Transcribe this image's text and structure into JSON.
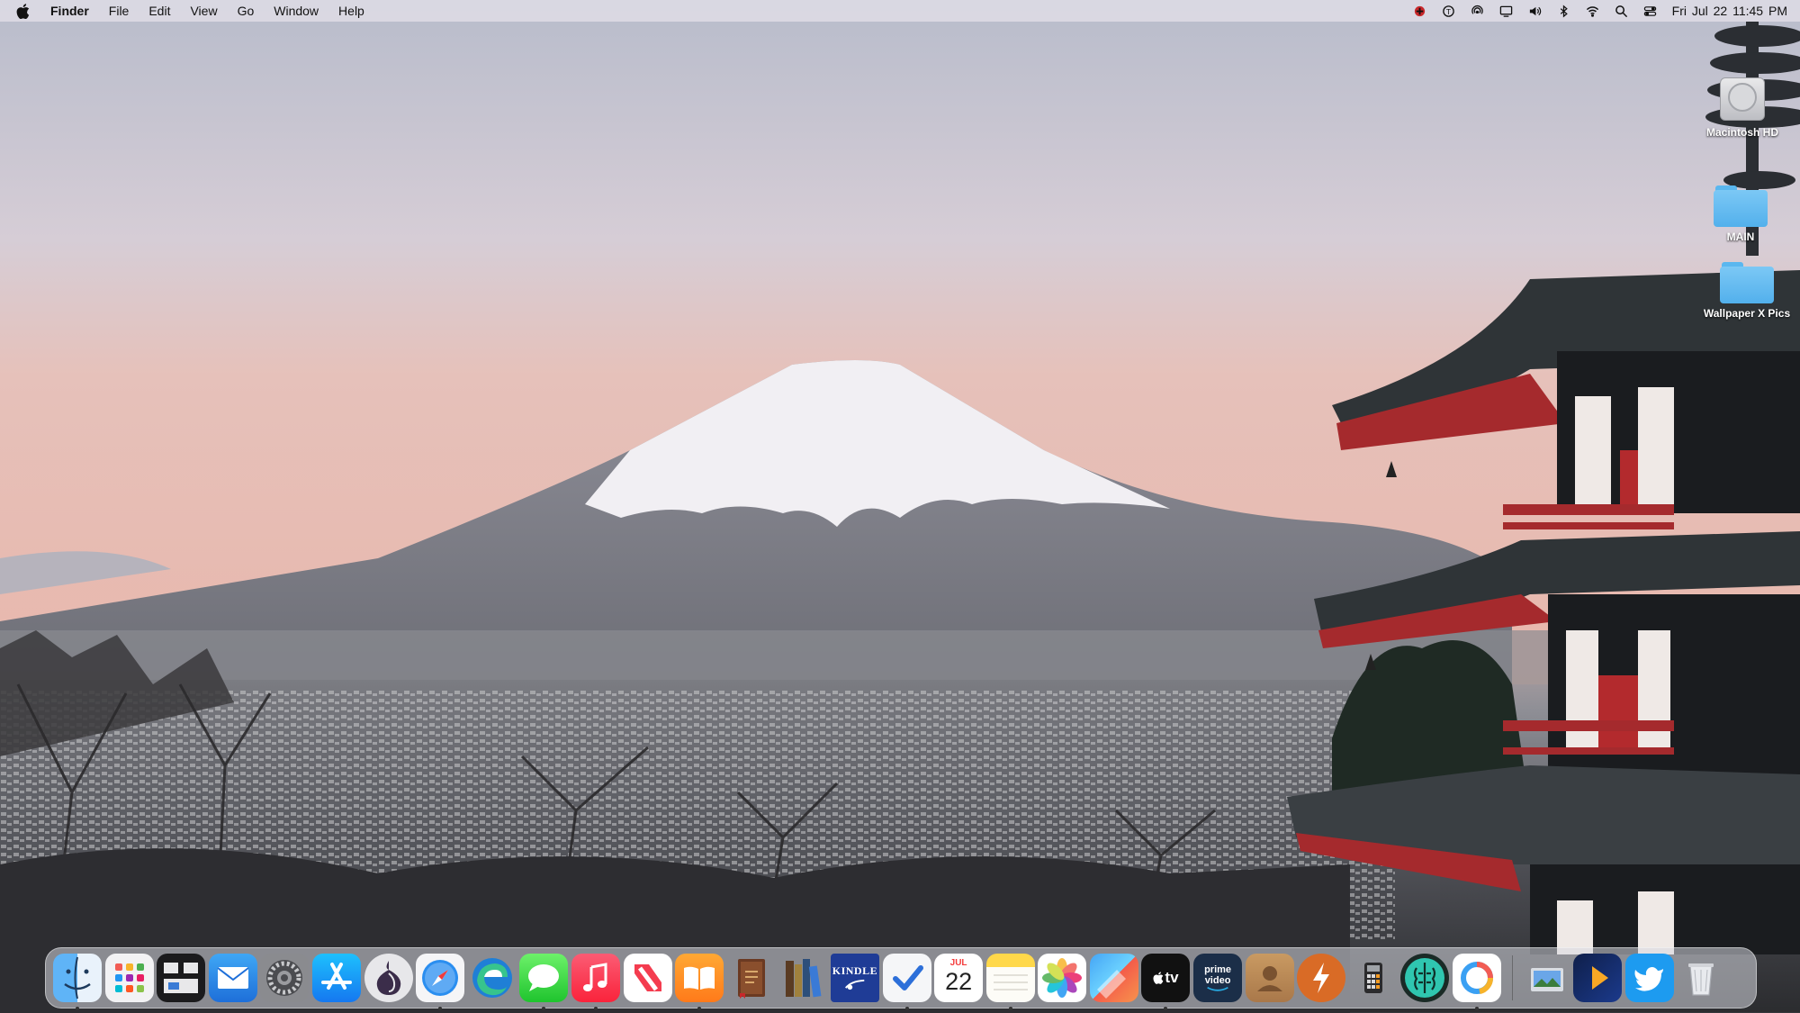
{
  "menubar": {
    "apple_icon": "apple-icon",
    "app_name": "Finder",
    "menus": [
      "File",
      "Edit",
      "View",
      "Go",
      "Window",
      "Help"
    ],
    "status_icons": [
      "antivirus-icon",
      "spotlight-helper-icon",
      "airdrop-icon",
      "display-icon",
      "volume-icon",
      "bluetooth-icon",
      "wifi-icon",
      "search-icon",
      "control-center-icon"
    ],
    "clock": "Fri Jul 22  11:45 PM"
  },
  "desktop_icons": [
    {
      "name": "macintosh-hd",
      "label": "Macintosh HD",
      "icon": "hard-drive-icon"
    },
    {
      "name": "main-folder",
      "label": "MAIN",
      "icon": "folder-icon"
    },
    {
      "name": "wallpaper-folder",
      "label": "Wallpaper X Pics",
      "icon": "folder-icon"
    }
  ],
  "dock": {
    "apps": [
      {
        "name": "finder",
        "icon": "finder-icon",
        "running": true
      },
      {
        "name": "launchpad",
        "icon": "launchpad-icon",
        "running": false
      },
      {
        "name": "mission-control",
        "icon": "mission-control-icon",
        "running": false
      },
      {
        "name": "mail",
        "icon": "mail-icon",
        "running": false
      },
      {
        "name": "system-preferences",
        "icon": "gear-icon",
        "running": false
      },
      {
        "name": "app-store",
        "icon": "app-store-icon",
        "running": false
      },
      {
        "name": "tor-browser",
        "icon": "onion-icon",
        "running": false
      },
      {
        "name": "safari",
        "icon": "compass-icon",
        "running": true
      },
      {
        "name": "edge",
        "icon": "edge-icon",
        "running": false
      },
      {
        "name": "messages",
        "icon": "speech-bubble-icon",
        "running": true
      },
      {
        "name": "music",
        "icon": "music-note-icon",
        "running": true
      },
      {
        "name": "news",
        "icon": "news-icon",
        "running": false
      },
      {
        "name": "books",
        "icon": "open-book-icon",
        "running": true
      },
      {
        "name": "audiobooks",
        "icon": "leather-book-icon",
        "running": false
      },
      {
        "name": "calibre",
        "icon": "bookshelf-icon",
        "running": false
      },
      {
        "name": "kindle",
        "icon": "kindle-icon",
        "label": "KINDLE",
        "running": false
      },
      {
        "name": "things",
        "icon": "checkmark-icon",
        "running": true
      },
      {
        "name": "calendar",
        "icon": "calendar-icon",
        "month": "JUL",
        "day": "22",
        "running": false
      },
      {
        "name": "notes",
        "icon": "notes-icon",
        "running": true
      },
      {
        "name": "photos",
        "icon": "photos-flower-icon",
        "running": false
      },
      {
        "name": "pixelmator",
        "icon": "paint-icon",
        "running": false
      },
      {
        "name": "apple-tv",
        "icon": "tv-icon",
        "label": "tv",
        "running": true
      },
      {
        "name": "prime-video",
        "icon": "prime-video-icon",
        "label": "prime video",
        "running": false
      },
      {
        "name": "contacts",
        "icon": "contacts-icon",
        "running": false
      },
      {
        "name": "reeder",
        "icon": "lightning-icon",
        "running": false
      },
      {
        "name": "calculator",
        "icon": "calculator-icon",
        "running": false
      },
      {
        "name": "brain-app",
        "icon": "brain-icon",
        "running": false
      },
      {
        "name": "istat",
        "icon": "ring-chart-icon",
        "running": true
      }
    ],
    "extras": [
      {
        "name": "preview",
        "icon": "preview-icon",
        "running": false
      },
      {
        "name": "infuse",
        "icon": "play-icon",
        "running": false
      },
      {
        "name": "twitter",
        "icon": "bird-icon",
        "running": false
      },
      {
        "name": "trash",
        "icon": "trash-icon",
        "running": false
      }
    ]
  }
}
